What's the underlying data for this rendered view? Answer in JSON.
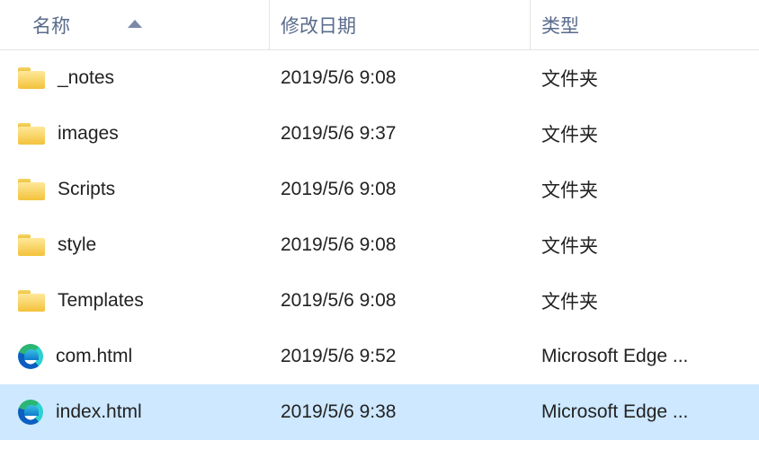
{
  "columns": {
    "name": "名称",
    "date": "修改日期",
    "type": "类型"
  },
  "sort": {
    "column": "name",
    "direction": "asc"
  },
  "items": [
    {
      "icon": "folder",
      "name": "_notes",
      "date": "2019/5/6 9:08",
      "type": "文件夹",
      "selected": false
    },
    {
      "icon": "folder",
      "name": "images",
      "date": "2019/5/6 9:37",
      "type": "文件夹",
      "selected": false
    },
    {
      "icon": "folder",
      "name": "Scripts",
      "date": "2019/5/6 9:08",
      "type": "文件夹",
      "selected": false
    },
    {
      "icon": "folder",
      "name": "style",
      "date": "2019/5/6 9:08",
      "type": "文件夹",
      "selected": false
    },
    {
      "icon": "folder",
      "name": "Templates",
      "date": "2019/5/6 9:08",
      "type": "文件夹",
      "selected": false
    },
    {
      "icon": "edge",
      "name": "com.html",
      "date": "2019/5/6 9:52",
      "type": "Microsoft Edge ...",
      "selected": false
    },
    {
      "icon": "edge",
      "name": "index.html",
      "date": "2019/5/6 9:38",
      "type": "Microsoft Edge ...",
      "selected": true
    }
  ]
}
